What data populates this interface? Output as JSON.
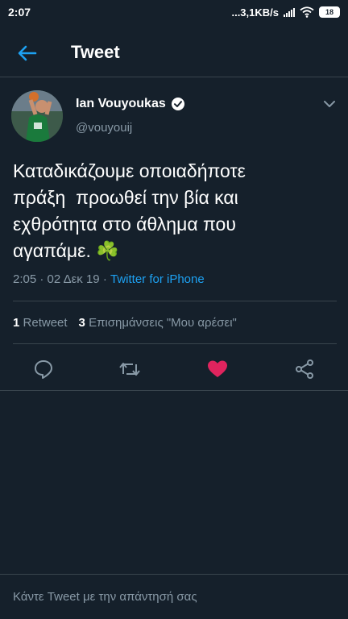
{
  "status_bar": {
    "time": "2:07",
    "network_speed": "...3,1KB/s",
    "battery": "18"
  },
  "header": {
    "title": "Tweet"
  },
  "tweet": {
    "author_name": "Ian Vouyoukas",
    "author_handle": "@vouyouij",
    "text": "Καταδικάζουμε οποιαδήποτε\nπράξη  προωθεί την βία και\nεχθρότητα στο άθλημα που\nαγαπάμε. ☘️",
    "time": "2:05",
    "date": "02 Δεκ 19",
    "source": "Twitter for iPhone",
    "retweet_count": "1",
    "retweet_label": "Retweet",
    "like_count": "3",
    "like_label": "Επισημάνσεις \"Μου αρέσει\""
  },
  "icons": {
    "back": "arrow-left-icon",
    "verified": "verified-badge-icon",
    "more": "chevron-down-icon",
    "reply": "comment-icon",
    "retweet": "retweet-icon",
    "like": "heart-icon",
    "share": "share-icon"
  },
  "colors": {
    "background": "#15202b",
    "accent": "#1da1f2",
    "like": "#e0245e",
    "muted": "#8899a6"
  },
  "reply": {
    "placeholder": "Κάντε Tweet με την απάντησή σας"
  }
}
